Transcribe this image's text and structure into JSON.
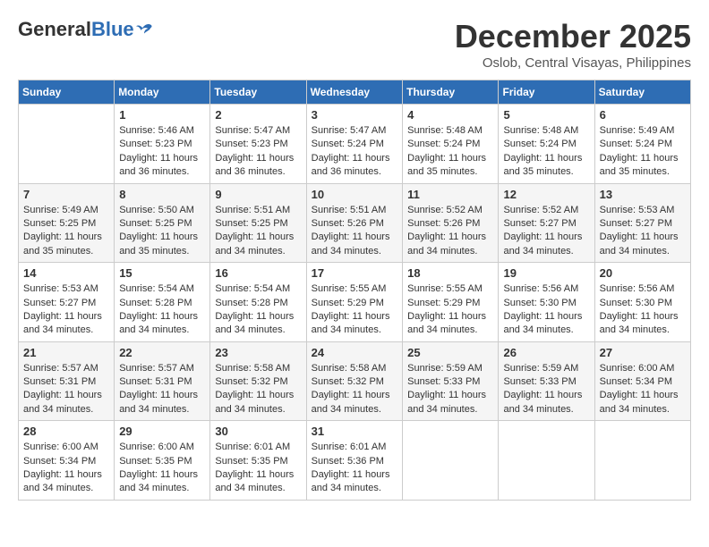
{
  "header": {
    "logo": {
      "general": "General",
      "blue": "Blue"
    },
    "title": "December 2025",
    "location": "Oslob, Central Visayas, Philippines"
  },
  "calendar": {
    "days_of_week": [
      "Sunday",
      "Monday",
      "Tuesday",
      "Wednesday",
      "Thursday",
      "Friday",
      "Saturday"
    ],
    "weeks": [
      [
        {
          "day": null,
          "info": null
        },
        {
          "day": "1",
          "sunrise": "Sunrise: 5:46 AM",
          "sunset": "Sunset: 5:23 PM",
          "daylight": "Daylight: 11 hours and 36 minutes."
        },
        {
          "day": "2",
          "sunrise": "Sunrise: 5:47 AM",
          "sunset": "Sunset: 5:23 PM",
          "daylight": "Daylight: 11 hours and 36 minutes."
        },
        {
          "day": "3",
          "sunrise": "Sunrise: 5:47 AM",
          "sunset": "Sunset: 5:24 PM",
          "daylight": "Daylight: 11 hours and 36 minutes."
        },
        {
          "day": "4",
          "sunrise": "Sunrise: 5:48 AM",
          "sunset": "Sunset: 5:24 PM",
          "daylight": "Daylight: 11 hours and 35 minutes."
        },
        {
          "day": "5",
          "sunrise": "Sunrise: 5:48 AM",
          "sunset": "Sunset: 5:24 PM",
          "daylight": "Daylight: 11 hours and 35 minutes."
        },
        {
          "day": "6",
          "sunrise": "Sunrise: 5:49 AM",
          "sunset": "Sunset: 5:24 PM",
          "daylight": "Daylight: 11 hours and 35 minutes."
        }
      ],
      [
        {
          "day": "7",
          "sunrise": "Sunrise: 5:49 AM",
          "sunset": "Sunset: 5:25 PM",
          "daylight": "Daylight: 11 hours and 35 minutes."
        },
        {
          "day": "8",
          "sunrise": "Sunrise: 5:50 AM",
          "sunset": "Sunset: 5:25 PM",
          "daylight": "Daylight: 11 hours and 35 minutes."
        },
        {
          "day": "9",
          "sunrise": "Sunrise: 5:51 AM",
          "sunset": "Sunset: 5:25 PM",
          "daylight": "Daylight: 11 hours and 34 minutes."
        },
        {
          "day": "10",
          "sunrise": "Sunrise: 5:51 AM",
          "sunset": "Sunset: 5:26 PM",
          "daylight": "Daylight: 11 hours and 34 minutes."
        },
        {
          "day": "11",
          "sunrise": "Sunrise: 5:52 AM",
          "sunset": "Sunset: 5:26 PM",
          "daylight": "Daylight: 11 hours and 34 minutes."
        },
        {
          "day": "12",
          "sunrise": "Sunrise: 5:52 AM",
          "sunset": "Sunset: 5:27 PM",
          "daylight": "Daylight: 11 hours and 34 minutes."
        },
        {
          "day": "13",
          "sunrise": "Sunrise: 5:53 AM",
          "sunset": "Sunset: 5:27 PM",
          "daylight": "Daylight: 11 hours and 34 minutes."
        }
      ],
      [
        {
          "day": "14",
          "sunrise": "Sunrise: 5:53 AM",
          "sunset": "Sunset: 5:27 PM",
          "daylight": "Daylight: 11 hours and 34 minutes."
        },
        {
          "day": "15",
          "sunrise": "Sunrise: 5:54 AM",
          "sunset": "Sunset: 5:28 PM",
          "daylight": "Daylight: 11 hours and 34 minutes."
        },
        {
          "day": "16",
          "sunrise": "Sunrise: 5:54 AM",
          "sunset": "Sunset: 5:28 PM",
          "daylight": "Daylight: 11 hours and 34 minutes."
        },
        {
          "day": "17",
          "sunrise": "Sunrise: 5:55 AM",
          "sunset": "Sunset: 5:29 PM",
          "daylight": "Daylight: 11 hours and 34 minutes."
        },
        {
          "day": "18",
          "sunrise": "Sunrise: 5:55 AM",
          "sunset": "Sunset: 5:29 PM",
          "daylight": "Daylight: 11 hours and 34 minutes."
        },
        {
          "day": "19",
          "sunrise": "Sunrise: 5:56 AM",
          "sunset": "Sunset: 5:30 PM",
          "daylight": "Daylight: 11 hours and 34 minutes."
        },
        {
          "day": "20",
          "sunrise": "Sunrise: 5:56 AM",
          "sunset": "Sunset: 5:30 PM",
          "daylight": "Daylight: 11 hours and 34 minutes."
        }
      ],
      [
        {
          "day": "21",
          "sunrise": "Sunrise: 5:57 AM",
          "sunset": "Sunset: 5:31 PM",
          "daylight": "Daylight: 11 hours and 34 minutes."
        },
        {
          "day": "22",
          "sunrise": "Sunrise: 5:57 AM",
          "sunset": "Sunset: 5:31 PM",
          "daylight": "Daylight: 11 hours and 34 minutes."
        },
        {
          "day": "23",
          "sunrise": "Sunrise: 5:58 AM",
          "sunset": "Sunset: 5:32 PM",
          "daylight": "Daylight: 11 hours and 34 minutes."
        },
        {
          "day": "24",
          "sunrise": "Sunrise: 5:58 AM",
          "sunset": "Sunset: 5:32 PM",
          "daylight": "Daylight: 11 hours and 34 minutes."
        },
        {
          "day": "25",
          "sunrise": "Sunrise: 5:59 AM",
          "sunset": "Sunset: 5:33 PM",
          "daylight": "Daylight: 11 hours and 34 minutes."
        },
        {
          "day": "26",
          "sunrise": "Sunrise: 5:59 AM",
          "sunset": "Sunset: 5:33 PM",
          "daylight": "Daylight: 11 hours and 34 minutes."
        },
        {
          "day": "27",
          "sunrise": "Sunrise: 6:00 AM",
          "sunset": "Sunset: 5:34 PM",
          "daylight": "Daylight: 11 hours and 34 minutes."
        }
      ],
      [
        {
          "day": "28",
          "sunrise": "Sunrise: 6:00 AM",
          "sunset": "Sunset: 5:34 PM",
          "daylight": "Daylight: 11 hours and 34 minutes."
        },
        {
          "day": "29",
          "sunrise": "Sunrise: 6:00 AM",
          "sunset": "Sunset: 5:35 PM",
          "daylight": "Daylight: 11 hours and 34 minutes."
        },
        {
          "day": "30",
          "sunrise": "Sunrise: 6:01 AM",
          "sunset": "Sunset: 5:35 PM",
          "daylight": "Daylight: 11 hours and 34 minutes."
        },
        {
          "day": "31",
          "sunrise": "Sunrise: 6:01 AM",
          "sunset": "Sunset: 5:36 PM",
          "daylight": "Daylight: 11 hours and 34 minutes."
        },
        {
          "day": null,
          "info": null
        },
        {
          "day": null,
          "info": null
        },
        {
          "day": null,
          "info": null
        }
      ]
    ]
  }
}
